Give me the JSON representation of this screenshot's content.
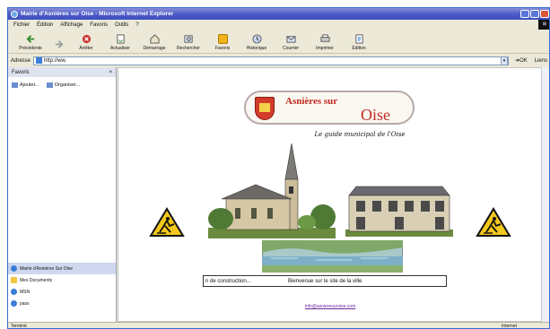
{
  "window": {
    "title": "Mairie d'Asnières sur Oise - Microsoft Internet Explorer"
  },
  "menu": [
    "Fichier",
    "Édition",
    "Affichage",
    "Favoris",
    "Outils",
    "?"
  ],
  "toolbar": [
    {
      "label": "Précédente",
      "icon": "back-arrow-icon"
    },
    {
      "label": "",
      "icon": "forward-arrow-icon"
    },
    {
      "label": "Arrêter",
      "icon": "stop-icon"
    },
    {
      "label": "Actualiser",
      "icon": "refresh-icon"
    },
    {
      "label": "Démarrage",
      "icon": "home-icon"
    },
    {
      "label": "Rechercher",
      "icon": "search-icon"
    },
    {
      "label": "Favoris",
      "icon": "favorites-icon"
    },
    {
      "label": "Historique",
      "icon": "history-icon"
    },
    {
      "label": "Courrier",
      "icon": "mail-icon"
    },
    {
      "label": "Imprimer",
      "icon": "print-icon"
    },
    {
      "label": "Édition",
      "icon": "edit-icon"
    }
  ],
  "address": {
    "label": "Adresse",
    "value": "http://ww.",
    "go": "OK",
    "links": "Liens"
  },
  "favorites": {
    "title": "Favoris",
    "close": "×",
    "add": "Ajouter...",
    "organize": "Organiser...",
    "items": [
      {
        "label": "Mairie d'Asnières Sur Oise",
        "selected": true
      },
      {
        "label": "Mes Documents",
        "selected": false
      },
      {
        "label": "MSN",
        "selected": false
      },
      {
        "label": "pass",
        "selected": false
      }
    ]
  },
  "page": {
    "logo_line1": "Asnières sur",
    "logo_line2": "Oise",
    "subtitle": "Le guide municipal de l'Oise",
    "ticker_left": "n de construction...",
    "ticker_right": "Bienvenue sur le site de la ville",
    "email": "info@asnieresuroise.com"
  },
  "status": {
    "left": "Terminé",
    "zone": "Internet"
  },
  "colors": {
    "accent": "#c12a1e",
    "titlebar": "#4e5cc8",
    "warning": "#f3c81c"
  }
}
